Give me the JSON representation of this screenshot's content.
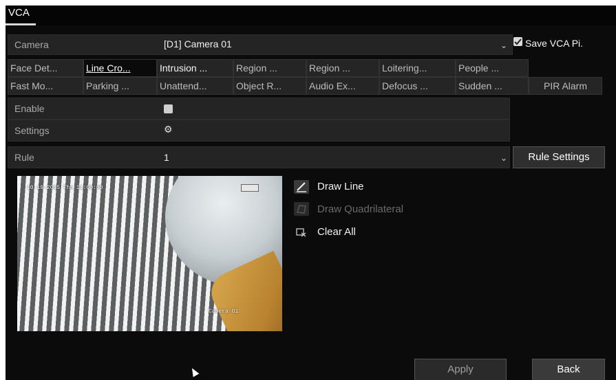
{
  "window": {
    "title": "VCA"
  },
  "camera": {
    "label": "Camera",
    "value": "[D1] Camera 01",
    "save_label": "Save VCA Pi.",
    "save_checked": true
  },
  "tabs_row1": [
    "Face Det...",
    "Line Cro...",
    "Intrusion ...",
    "Region ...",
    "Region ...",
    "Loitering...",
    "People ..."
  ],
  "tabs_row2": [
    "Fast Mo...",
    "Parking ...",
    "Unattend...",
    "Object R...",
    "Audio Ex...",
    "Defocus ...",
    "Sudden ...",
    "PIR Alarm"
  ],
  "active_tab": "Line Cro...",
  "enable": {
    "label": "Enable",
    "checked": false
  },
  "settings": {
    "label": "Settings",
    "icon": "gear-icon"
  },
  "rule": {
    "label": "Rule",
    "value": "1",
    "button": "Rule Settings"
  },
  "video": {
    "timestamp": "10-19-2015 Thu 11:00:00",
    "camera_overlay": "Camera 01"
  },
  "tools": [
    {
      "label": "Draw Line",
      "icon": "pencil-icon",
      "enabled": true
    },
    {
      "label": "Draw Quadrilateral",
      "icon": "quadrilateral-icon",
      "enabled": false
    },
    {
      "label": "Clear All",
      "icon": "clear-icon",
      "enabled": true
    }
  ],
  "footer": {
    "apply": "Apply",
    "back": "Back"
  },
  "colors": {
    "background": "#0b0b0b",
    "panel": "#242424",
    "checkbox_checked": "#d9d9d9"
  }
}
